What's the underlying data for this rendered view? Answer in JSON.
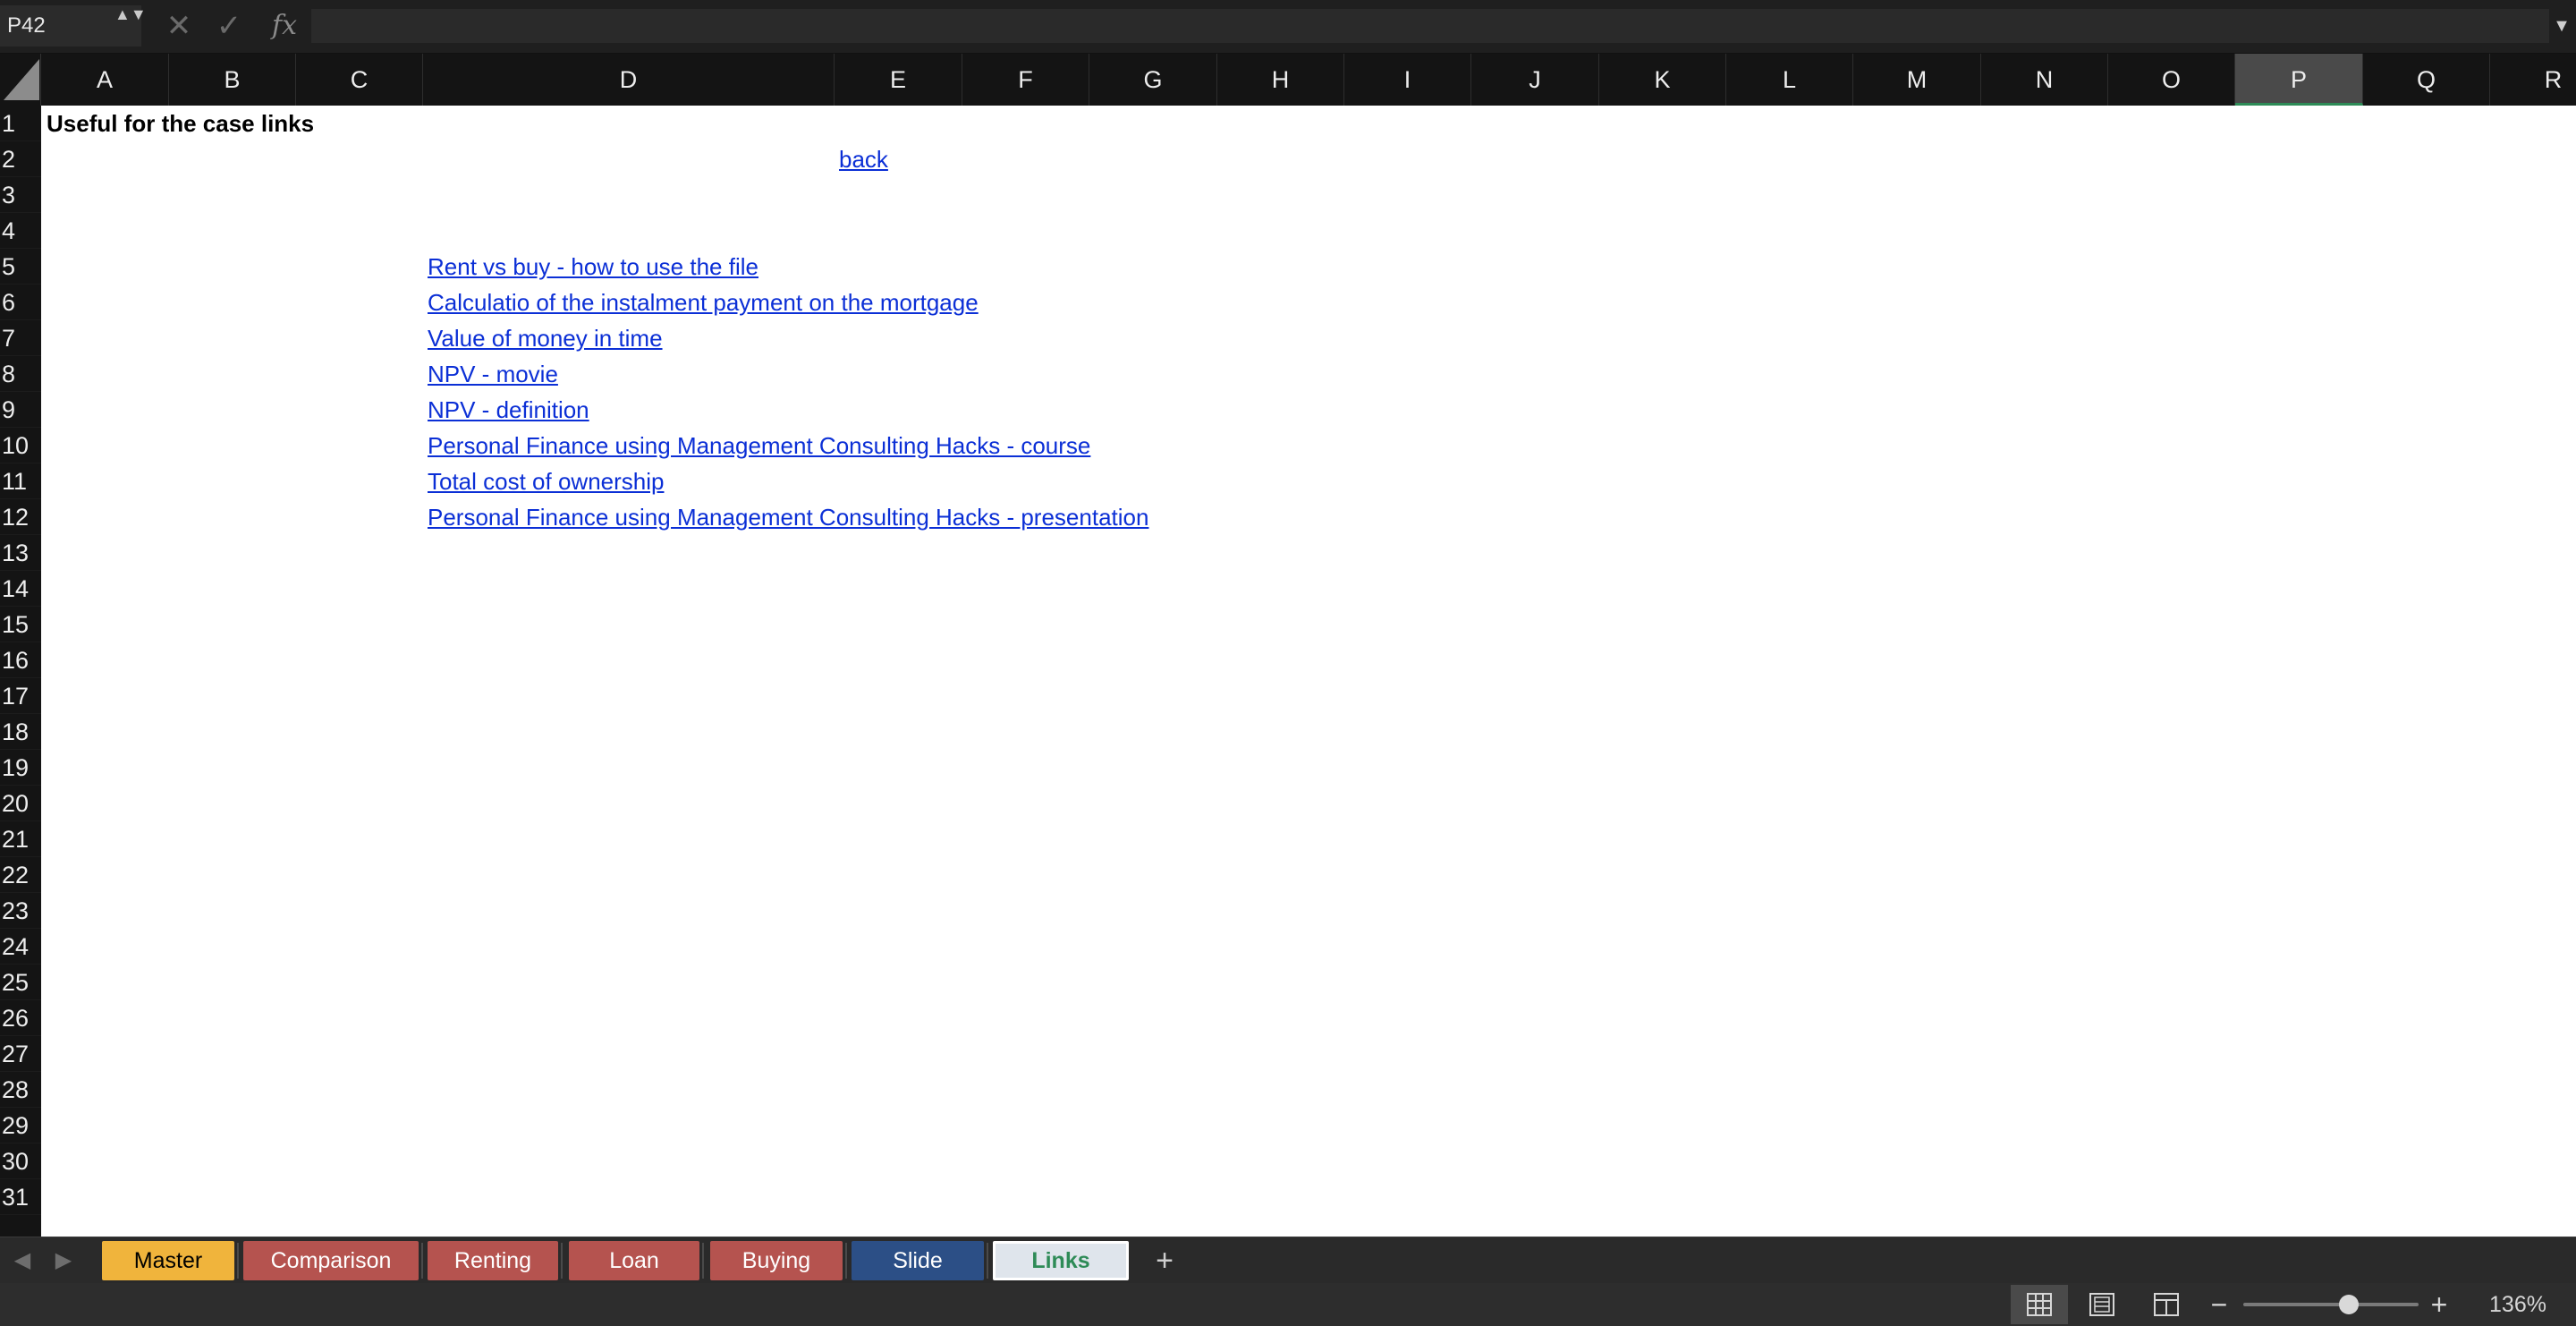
{
  "formula_bar": {
    "name_box": "P42",
    "name_box_stepper": "▲▼",
    "cancel_icon": "✕",
    "enter_icon": "✓",
    "fx_label": "fx",
    "formula_value": "",
    "expand_icon": "▼"
  },
  "columns": [
    "A",
    "B",
    "C",
    "D",
    "E",
    "F",
    "G",
    "H",
    "I",
    "J",
    "K",
    "L",
    "M",
    "N",
    "O",
    "P",
    "Q",
    "R"
  ],
  "selected_column": "P",
  "rows": [
    "1",
    "2",
    "3",
    "4",
    "5",
    "6",
    "7",
    "8",
    "9",
    "10",
    "11",
    "12",
    "13",
    "14",
    "15",
    "16",
    "17",
    "18",
    "19",
    "20",
    "21",
    "22",
    "23",
    "24",
    "25",
    "26",
    "27",
    "28",
    "29",
    "30",
    "31"
  ],
  "cells": {
    "A1": "Useful for the case links",
    "E2": "back",
    "D5": "Rent vs buy - how to use the file",
    "D6": "Calculatio of the instalment payment on the mortgage",
    "D7": "Value of money in time",
    "D8": "NPV - movie",
    "D9": "NPV - definition",
    "D10": "Personal Finance using Management Consulting Hacks - course",
    "D11": "Total cost of ownership",
    "D12": "Personal Finance using Management Consulting Hacks - presentation"
  },
  "link_color": "#0b2fd6",
  "sheet_tabs": [
    {
      "label": "Master",
      "color": "#f0b43c",
      "text_color": "#000000",
      "active": false
    },
    {
      "label": "Comparison",
      "color": "#b5534f",
      "text_color": "#ffffff",
      "active": false
    },
    {
      "label": "Renting",
      "color": "#b5534f",
      "text_color": "#ffffff",
      "active": false
    },
    {
      "label": "Loan",
      "color": "#b5534f",
      "text_color": "#ffffff",
      "active": false
    },
    {
      "label": "Buying",
      "color": "#b5534f",
      "text_color": "#ffffff",
      "active": false
    },
    {
      "label": "Slide",
      "color": "#2c4f86",
      "text_color": "#ffffff",
      "active": false
    },
    {
      "label": "Links",
      "color": "#dfe5ec",
      "text_color": "#2e8b57",
      "active": true
    }
  ],
  "tab_nav": {
    "prev": "◀",
    "next": "▶",
    "add": "+"
  },
  "status_bar": {
    "zoom_out": "−",
    "zoom_in": "+",
    "zoom_level": "136%",
    "zoom_fraction": 0.6
  }
}
